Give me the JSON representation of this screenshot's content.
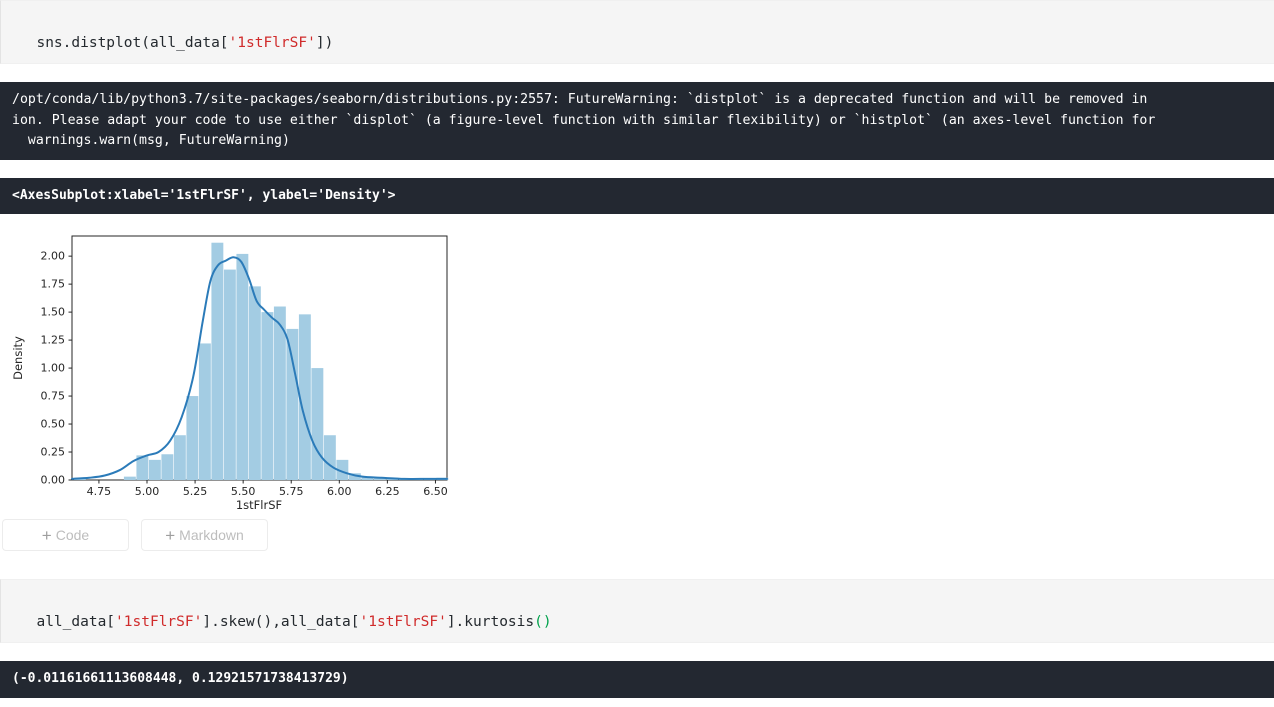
{
  "cells": [
    {
      "type": "code",
      "name": "code-cell-distplot",
      "segments": [
        {
          "text": "sns.distplot(all_data[",
          "style": "plain"
        },
        {
          "text": "'1stFlrSF'",
          "style": "string"
        },
        {
          "text": "])",
          "style": "plain"
        }
      ],
      "raw": "sns.distplot(all_data['1stFlrSF'])"
    }
  ],
  "warning_output": {
    "name": "stderr-futurewarning",
    "lines": [
      "/opt/conda/lib/python3.7/site-packages/seaborn/distributions.py:2557: FutureWarning: `distplot` is a deprecated function and will be removed in",
      "ion. Please adapt your code to use either `displot` (a figure-level function with similar flexibility) or `histplot` (an axes-level function for",
      "  warnings.warn(msg, FutureWarning)"
    ]
  },
  "repr_output": {
    "name": "axessubplot-repr",
    "text": "<AxesSubplot:xlabel='1stFlrSF', ylabel='Density'>"
  },
  "add_buttons": [
    {
      "name": "add-code-button",
      "label": "Code",
      "icon": "plus-icon"
    },
    {
      "name": "add-markdown-button",
      "label": "Markdown",
      "icon": "plus-icon"
    }
  ],
  "skew_cell": {
    "name": "code-cell-skew-kurtosis",
    "segments": [
      {
        "text": "all_data[",
        "style": "plain"
      },
      {
        "text": "'1stFlrSF'",
        "style": "string"
      },
      {
        "text": "].skew(),all_data[",
        "style": "plain"
      },
      {
        "text": "'1stFlrSF'",
        "style": "string"
      },
      {
        "text": "].kurtosis",
        "style": "plain"
      },
      {
        "text": "()",
        "style": "green"
      }
    ],
    "raw": "all_data['1stFlrSF'].skew(),all_data['1stFlrSF'].kurtosis()"
  },
  "skew_output": {
    "name": "skew-kurtosis-result",
    "text": "(-0.01161661113608448, 0.12921571738413729)",
    "skew": -0.01161661113608448,
    "kurtosis": 0.12921571738413729
  },
  "corner_chip": {
    "name": "scroll-indicator-chip",
    "glyph": "||"
  },
  "colors": {
    "hist_fill": "#a3cce3",
    "kde_line": "#2b7bb9",
    "cell_bg": "#f5f5f5",
    "output_bg": "#232831",
    "string_token": "#d02b2b",
    "green_token": "#00a14b",
    "axis": "#262626"
  },
  "chart_data": {
    "type": "bar",
    "title": "",
    "xlabel": "1stFlrSF",
    "ylabel": "Density",
    "xlim": [
      4.61,
      6.56
    ],
    "ylim": [
      0.0,
      2.18
    ],
    "grid": false,
    "legend": null,
    "xticks": [
      4.75,
      5.0,
      5.25,
      5.5,
      5.75,
      6.0,
      6.25,
      6.5
    ],
    "xticklabels": [
      "4.75",
      "5.00",
      "5.25",
      "5.50",
      "5.75",
      "6.00",
      "6.25",
      "6.50"
    ],
    "yticks": [
      0.0,
      0.25,
      0.5,
      0.75,
      1.0,
      1.25,
      1.5,
      1.75,
      2.0
    ],
    "yticklabels": [
      "0.00",
      "0.25",
      "0.50",
      "0.75",
      "1.00",
      "1.25",
      "1.50",
      "1.75",
      "2.00"
    ],
    "bin_edges": [
      4.62,
      4.685,
      4.75,
      4.815,
      4.88,
      4.945,
      5.01,
      5.075,
      5.14,
      5.205,
      5.27,
      5.335,
      5.4,
      5.465,
      5.53,
      5.595,
      5.66,
      5.725,
      5.79,
      5.855,
      5.92,
      5.985,
      6.05,
      6.115,
      6.18,
      6.245,
      6.31,
      6.375,
      6.44,
      6.505,
      6.57
    ],
    "values": [
      0.02,
      0.0,
      0.0,
      0.0,
      0.03,
      0.22,
      0.18,
      0.23,
      0.4,
      0.75,
      1.22,
      2.12,
      1.88,
      2.02,
      1.73,
      1.5,
      1.55,
      1.35,
      1.48,
      1.0,
      0.4,
      0.18,
      0.06,
      0.03,
      0.02,
      0.02,
      0.01,
      0.01,
      0.01,
      0.02
    ],
    "kde": {
      "name": "kde-curve",
      "x": [
        4.61,
        4.7,
        4.78,
        4.86,
        4.93,
        5.0,
        5.06,
        5.12,
        5.18,
        5.24,
        5.29,
        5.33,
        5.37,
        5.41,
        5.45,
        5.49,
        5.53,
        5.57,
        5.61,
        5.65,
        5.69,
        5.73,
        5.77,
        5.81,
        5.86,
        5.91,
        5.97,
        6.04,
        6.12,
        6.22,
        6.34,
        6.46,
        6.56
      ],
      "y": [
        0.01,
        0.02,
        0.04,
        0.09,
        0.17,
        0.22,
        0.25,
        0.35,
        0.56,
        0.92,
        1.42,
        1.78,
        1.92,
        1.96,
        1.99,
        1.95,
        1.8,
        1.6,
        1.52,
        1.45,
        1.39,
        1.26,
        0.95,
        0.62,
        0.35,
        0.2,
        0.11,
        0.06,
        0.03,
        0.02,
        0.01,
        0.01,
        0.01
      ]
    }
  }
}
